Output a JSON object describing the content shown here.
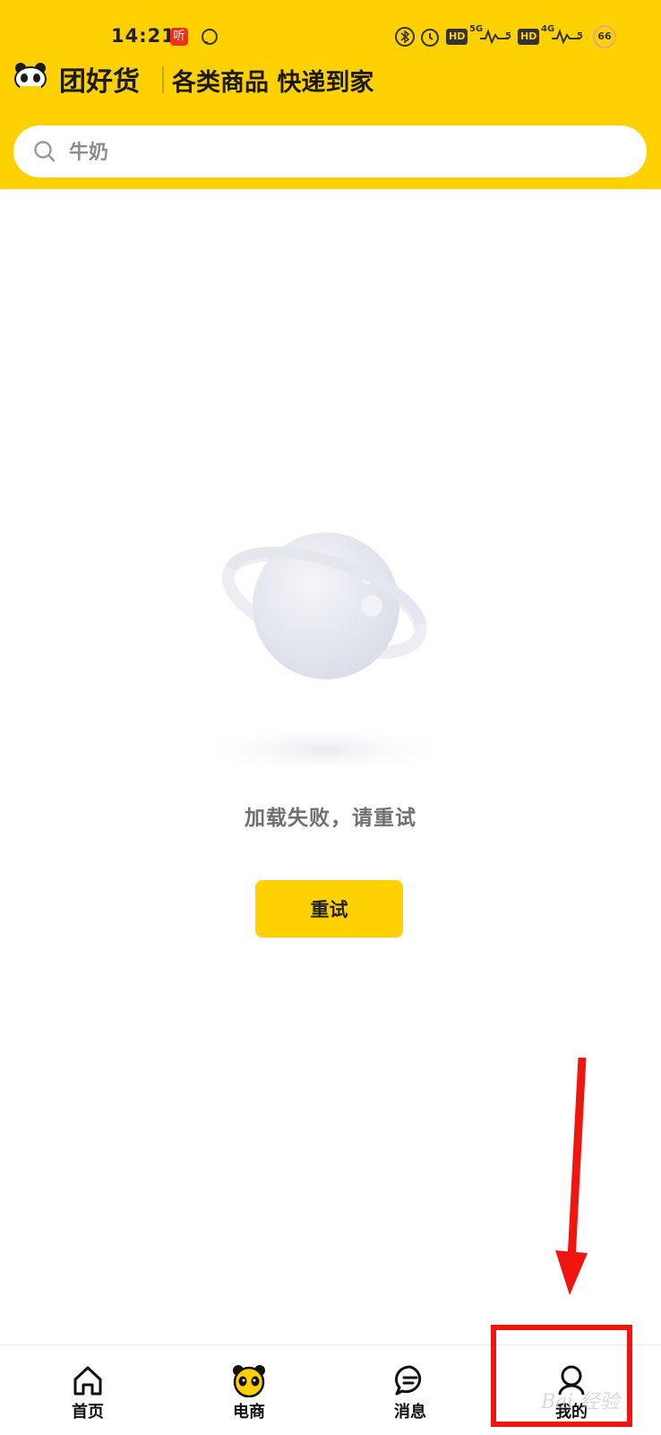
{
  "status_bar": {
    "time": "14:21",
    "badge_text": "听",
    "hd_label": "HD",
    "net_5g": "5G",
    "net_4g": "4G",
    "signal_a": "5",
    "signal_b": "5",
    "battery": "66"
  },
  "header": {
    "app_name": "团好货",
    "slogan": "各类商品 快递到家"
  },
  "search": {
    "placeholder": "牛奶"
  },
  "empty_state": {
    "message": "加载失败，请重试",
    "retry_label": "重试"
  },
  "tab_bar": {
    "tabs": [
      {
        "label": "首页",
        "icon": "home-icon"
      },
      {
        "label": "电商",
        "icon": "panda-icon"
      },
      {
        "label": "消息",
        "icon": "message-icon"
      },
      {
        "label": "我的",
        "icon": "user-icon"
      }
    ]
  },
  "watermark": "Bai 经验",
  "colors": {
    "brand_yellow": "#FFD100",
    "annotation_red": "#F0150F"
  }
}
